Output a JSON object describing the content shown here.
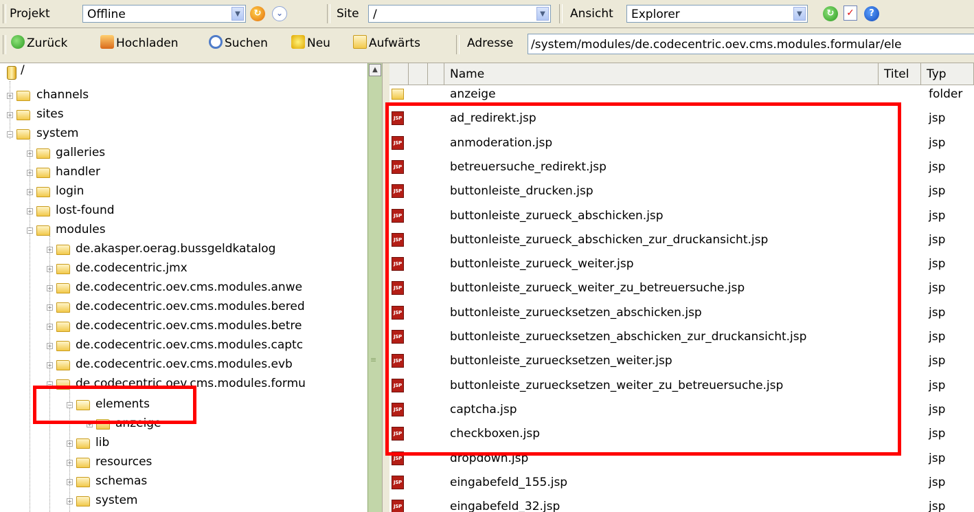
{
  "toolbar1": {
    "projekt_label": "Projekt",
    "projekt_value": "Offline",
    "site_label": "Site",
    "site_value": "/",
    "ansicht_label": "Ansicht",
    "ansicht_value": "Explorer"
  },
  "toolbar2": {
    "back_label": "Zurück",
    "upload_label": "Hochladen",
    "search_label": "Suchen",
    "new_label": "Neu",
    "up_label": "Aufwärts",
    "address_label": "Adresse",
    "address_value": "/system/modules/de.codecentric.oev.cms.modules.formular/ele"
  },
  "tree": {
    "root": "/",
    "nodes": [
      {
        "label": "channels"
      },
      {
        "label": "sites"
      },
      {
        "label": "system"
      },
      {
        "label": "galleries"
      },
      {
        "label": "handler"
      },
      {
        "label": "login"
      },
      {
        "label": "lost-found"
      },
      {
        "label": "modules"
      },
      {
        "label": "de.akasper.oerag.bussgeldkatalog"
      },
      {
        "label": "de.codecentric.jmx"
      },
      {
        "label": "de.codecentric.oev.cms.modules.anwe"
      },
      {
        "label": "de.codecentric.oev.cms.modules.bered"
      },
      {
        "label": "de.codecentric.oev.cms.modules.betre"
      },
      {
        "label": "de.codecentric.oev.cms.modules.captc"
      },
      {
        "label": "de.codecentric.oev.cms.modules.evb"
      },
      {
        "label": "de.codecentric.oev.cms.modules.formu"
      },
      {
        "label": "elements"
      },
      {
        "label": "anzeige"
      },
      {
        "label": "lib"
      },
      {
        "label": "resources"
      },
      {
        "label": "schemas"
      },
      {
        "label": "system"
      }
    ]
  },
  "list": {
    "columns": {
      "name": "Name",
      "titel": "Titel",
      "typ": "Typ"
    },
    "rows": [
      {
        "name": "anzeige",
        "typ": "folder"
      },
      {
        "name": "ad_redirekt.jsp",
        "typ": "jsp"
      },
      {
        "name": "anmoderation.jsp",
        "typ": "jsp"
      },
      {
        "name": "betreuersuche_redirekt.jsp",
        "typ": "jsp"
      },
      {
        "name": "buttonleiste_drucken.jsp",
        "typ": "jsp"
      },
      {
        "name": "buttonleiste_zurueck_abschicken.jsp",
        "typ": "jsp"
      },
      {
        "name": "buttonleiste_zurueck_abschicken_zur_druckansicht.jsp",
        "typ": "jsp"
      },
      {
        "name": "buttonleiste_zurueck_weiter.jsp",
        "typ": "jsp"
      },
      {
        "name": "buttonleiste_zurueck_weiter_zu_betreuersuche.jsp",
        "typ": "jsp"
      },
      {
        "name": "buttonleiste_zuruecksetzen_abschicken.jsp",
        "typ": "jsp"
      },
      {
        "name": "buttonleiste_zuruecksetzen_abschicken_zur_druckansicht.jsp",
        "typ": "jsp"
      },
      {
        "name": "buttonleiste_zuruecksetzen_weiter.jsp",
        "typ": "jsp"
      },
      {
        "name": "buttonleiste_zuruecksetzen_weiter_zu_betreuersuche.jsp",
        "typ": "jsp"
      },
      {
        "name": "captcha.jsp",
        "typ": "jsp"
      },
      {
        "name": "checkboxen.jsp",
        "typ": "jsp"
      },
      {
        "name": "dropdown.jsp",
        "typ": "jsp"
      },
      {
        "name": "eingabefeld_155.jsp",
        "typ": "jsp"
      },
      {
        "name": "eingabefeld_32.jsp",
        "typ": "jsp"
      }
    ],
    "jsp_icon_text": "JSP"
  },
  "colors": {
    "highlight": "#ff0000",
    "toolbar_bg": "#ece9d8"
  }
}
